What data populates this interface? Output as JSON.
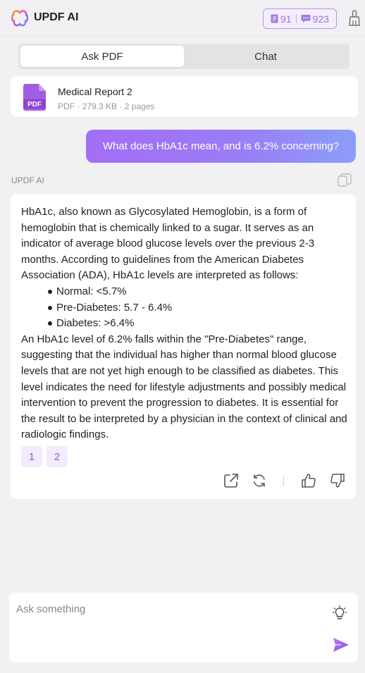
{
  "header": {
    "app_title": "UPDF AI",
    "credits": {
      "documents": "91",
      "messages": "923"
    }
  },
  "tabs": [
    {
      "label": "Ask PDF",
      "active": true
    },
    {
      "label": "Chat",
      "active": false
    }
  ],
  "file": {
    "name": "Medical Report 2",
    "meta": "PDF · 279.3 KB · 2 pages",
    "icon_label": "PDF"
  },
  "conversation": {
    "user_message": "What does HbA1c mean, and is 6.2% concerning?",
    "ai_label": "UPDF AI",
    "answer": {
      "intro": "HbA1c, also known as Glycosylated Hemoglobin, is a form of hemoglobin that is chemically linked to a sugar. It serves as an indicator of average blood glucose levels over the previous 2-3 months. According to guidelines from the American Diabetes Association (ADA), HbA1c levels are interpreted as follows:",
      "bullets": [
        "Normal: <5.7%",
        "Pre-Diabetes: 5.7 - 6.4%",
        "Diabetes: >6.4%"
      ],
      "conclusion": "An HbA1c level of 6.2% falls within the \"Pre-Diabetes\" range, suggesting that the individual has higher than normal blood glucose levels that are not yet high enough to be classified as diabetes. This level indicates the need for lifestyle adjustments and possibly medical intervention to prevent the progression to diabetes. It is essential for the result to be interpreted by a physician in the context of clinical and radiologic findings."
    },
    "page_refs": [
      "1",
      "2"
    ]
  },
  "input": {
    "placeholder": "Ask something"
  },
  "colors": {
    "accent": "#a36ef6",
    "accent_light": "#f3ecfd",
    "pdf_icon": "#a25ee0",
    "background": "#f1f1f3"
  },
  "icons": [
    "updf-logo-icon",
    "document-icon",
    "message-icon",
    "broom-icon",
    "pdf-file-icon",
    "copy-icon",
    "share-icon",
    "regenerate-icon",
    "thumbs-up-icon",
    "thumbs-down-icon",
    "lightbulb-icon",
    "send-icon"
  ]
}
